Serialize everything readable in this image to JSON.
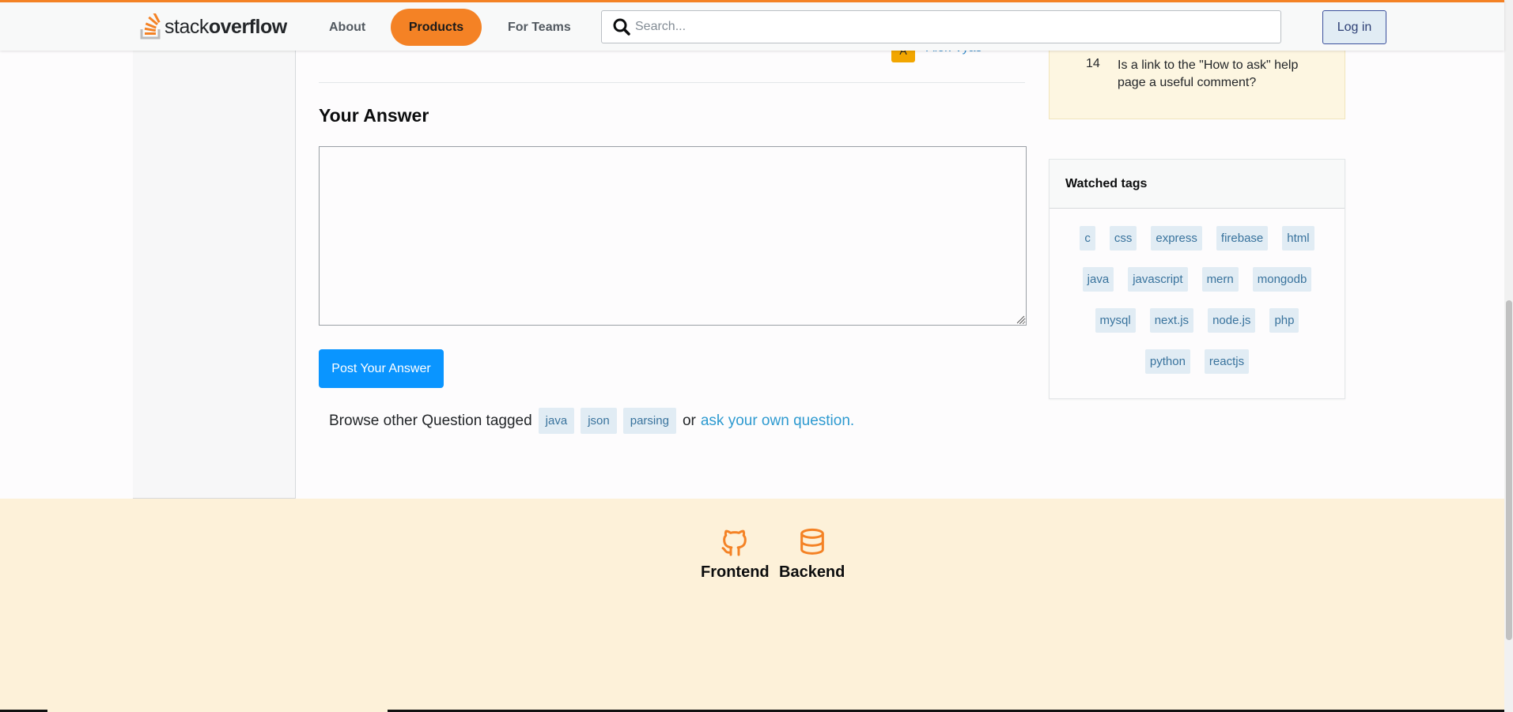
{
  "header": {
    "logo_word_light": "stack",
    "logo_word_bold": "overflow",
    "nav": {
      "about": "About",
      "products": "Products",
      "for_teams": "For Teams"
    },
    "search_placeholder": "Search...",
    "login_label": "Log in"
  },
  "answer_author": {
    "avatar_letter": "A",
    "name": "Alok Vyas"
  },
  "main": {
    "your_answer_title": "Your Answer",
    "answer_value": "",
    "post_button": "Post Your Answer",
    "browse_prefix": "Browse other Question tagged",
    "tags": [
      "java",
      "json",
      "parsing"
    ],
    "or_text": "or",
    "ask_link": "ask your own question."
  },
  "featured": {
    "count": "14",
    "text": "Is a link to the \"How to ask\" help page a useful comment?"
  },
  "watched_tags": {
    "title": "Watched tags",
    "tags": [
      "c",
      "css",
      "express",
      "firebase",
      "html",
      "java",
      "javascript",
      "mern",
      "mongodb",
      "mysql",
      "next.js",
      "node.js",
      "php",
      "python",
      "reactjs"
    ]
  },
  "footer": {
    "frontend": "Frontend",
    "backend": "Backend"
  },
  "colors": {
    "accent": "#f48225",
    "primary_button": "#0a95ff",
    "tag_bg": "#e1ecf4",
    "footer_bg": "#fdf1d9"
  }
}
